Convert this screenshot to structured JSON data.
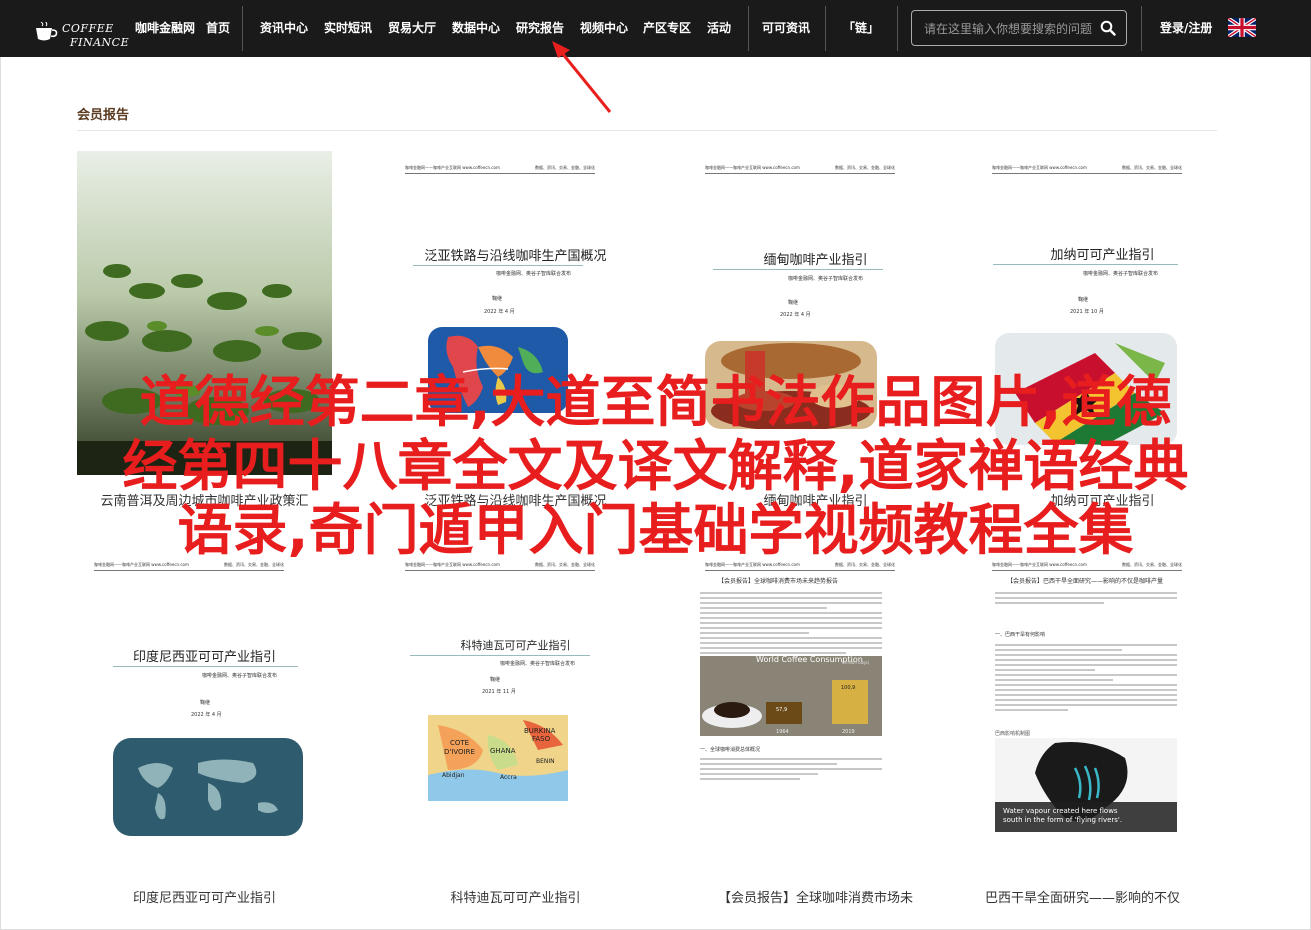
{
  "logo": {
    "line1": "COFFEE",
    "line2": "FINANCE"
  },
  "nav": {
    "site": "咖啡金融网",
    "home": "首页",
    "news": "资讯中心",
    "realtime": "实时短讯",
    "trade": "贸易大厅",
    "data": "数据中心",
    "research": "研究报告",
    "video": "视频中心",
    "region": "产区专区",
    "activity": "活动",
    "cocoa": "可可资讯",
    "chain": "「链」",
    "login": "登录/注册"
  },
  "search": {
    "placeholder": "请在这里输入你想要搜索的问题"
  },
  "section": {
    "title": "会员报告"
  },
  "doc_header": {
    "left": "咖啡金融网——咖啡产业互联网 www.coffeecn.com",
    "right": "数据、资讯、交易、金融、全球化"
  },
  "cards": [
    {
      "caption": "云南普洱及周边城市咖啡产业政策汇"
    },
    {
      "title": "泛亚铁路与沿线咖啡生产国概况",
      "publisher": "咖啡金融网、奥谷子智库联合发布",
      "dept": "鞠继",
      "date": "2022 年 4 月",
      "caption": "泛亚铁路与沿线咖啡生产国概况"
    },
    {
      "title": "缅甸咖啡产业指引",
      "publisher": "咖啡金融网、奥谷子智库联合发布",
      "dept": "鞠继",
      "date": "2022 年 4 月",
      "caption": "缅甸咖啡产业指引"
    },
    {
      "title": "加纳可可产业指引",
      "publisher": "咖啡金融网、奥谷子智库联合发布",
      "dept": "鞠继",
      "date": "2021 年 10 月",
      "caption": "加纳可可产业指引"
    },
    {
      "title": "印度尼西亚可可产业指引",
      "publisher": "咖啡金融网、奥谷子智库联合发布",
      "dept": "鞠继",
      "date": "2022 年 4 月",
      "caption": "印度尼西亚可可产业指引"
    },
    {
      "title": "科特迪瓦可可产业指引",
      "publisher": "咖啡金融网、奥谷子智库联合发布",
      "dept": "鞠继",
      "date": "2021 年 11 月",
      "caption": "科特迪瓦可可产业指引",
      "map_labels": {
        "burkina": "BURKINA",
        "faso": "FASO",
        "cote": "COTE",
        "divoire": "D'IVOIRE",
        "ghana": "GHANA",
        "benin": "BENIN",
        "abidjan": "Abidjan",
        "accra": "Accra"
      }
    },
    {
      "heading": "【会员报告】全球咖啡消费市场未来趋势报告",
      "chart_title": "World Coffee Consumption",
      "chart_unit": "(million bags)",
      "v1": "57,9",
      "v2": "100,9",
      "y1": "1964",
      "y2": "2019",
      "sub": "一、全球咖啡消费总体概况",
      "caption": "【会员报告】全球咖啡消费市场未"
    },
    {
      "heading": "【会员报告】巴西干旱全面研究——影响的不仅是咖啡产量",
      "sub": "一、巴西干旱有何影响",
      "img_label": "巴西影响机制图",
      "vapour1": "Water vapour created here flows",
      "vapour2": "south in the form of 'flying rivers'.",
      "caption": "巴西干旱全面研究——影响的不仅"
    }
  ],
  "overlay": {
    "line1": "道德经第二章,大道至简书法作品图片,道德",
    "line2": "经第四十八章全文及译文解释,道家禅语经典",
    "line3": "语录,奇门遁甲入门基础学视频教程全集"
  },
  "colors": {
    "topbar": "#1a1a1a",
    "overlay_red": "#e81d1d",
    "arrow_red": "#e8201e",
    "section_brown": "#5a3a20"
  }
}
